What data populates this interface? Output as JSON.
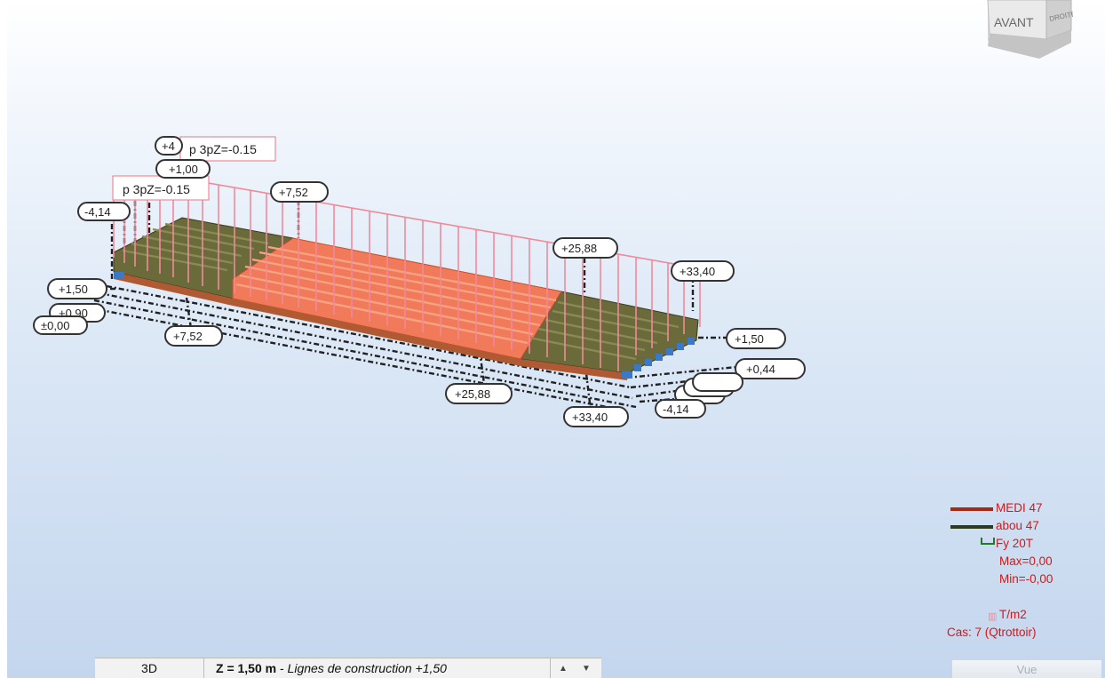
{
  "viewcube": {
    "face_front": "AVANT",
    "face_side": "DROITE"
  },
  "dimensions": {
    "top_left_cluster": [
      "+4",
      "+1,00",
      "-4,14"
    ],
    "top_mid": "+7,52",
    "top_right": "+25,88",
    "top_far": "+33,40",
    "left_levels": [
      "+1,50",
      "+0,90",
      "±0,00"
    ],
    "bottom_left": "+7,52",
    "bottom_mid": "+25,88",
    "bottom_right": "+33,40",
    "right_levels": [
      "+1,50",
      "+0,44",
      "-4,14"
    ]
  },
  "load_labels": [
    "p 3pZ=-0.15",
    "p 3pZ=-0.15"
  ],
  "legend": {
    "items": [
      {
        "label": "MEDI 47",
        "color": "#a42a14"
      },
      {
        "label": "abou 47",
        "color": "#2d3a1e"
      }
    ],
    "support_label": "Fy  20T",
    "max": "Max=0,00",
    "min": "Min=-0,00",
    "unit": "T/m2",
    "case": "Cas: 7 (Qtrottoir)"
  },
  "statusbar": {
    "mode": "3D",
    "level_bold": "Z = 1,50 m",
    "level_sep": " - ",
    "level_italic": "Lignes de construction +1,50"
  },
  "vue_button": "Vue",
  "colors": {
    "load": "#f08a9a",
    "slab_mid": "#f07a5a",
    "slab_end": "#6b6a3a",
    "legend_text": "#d41818"
  }
}
